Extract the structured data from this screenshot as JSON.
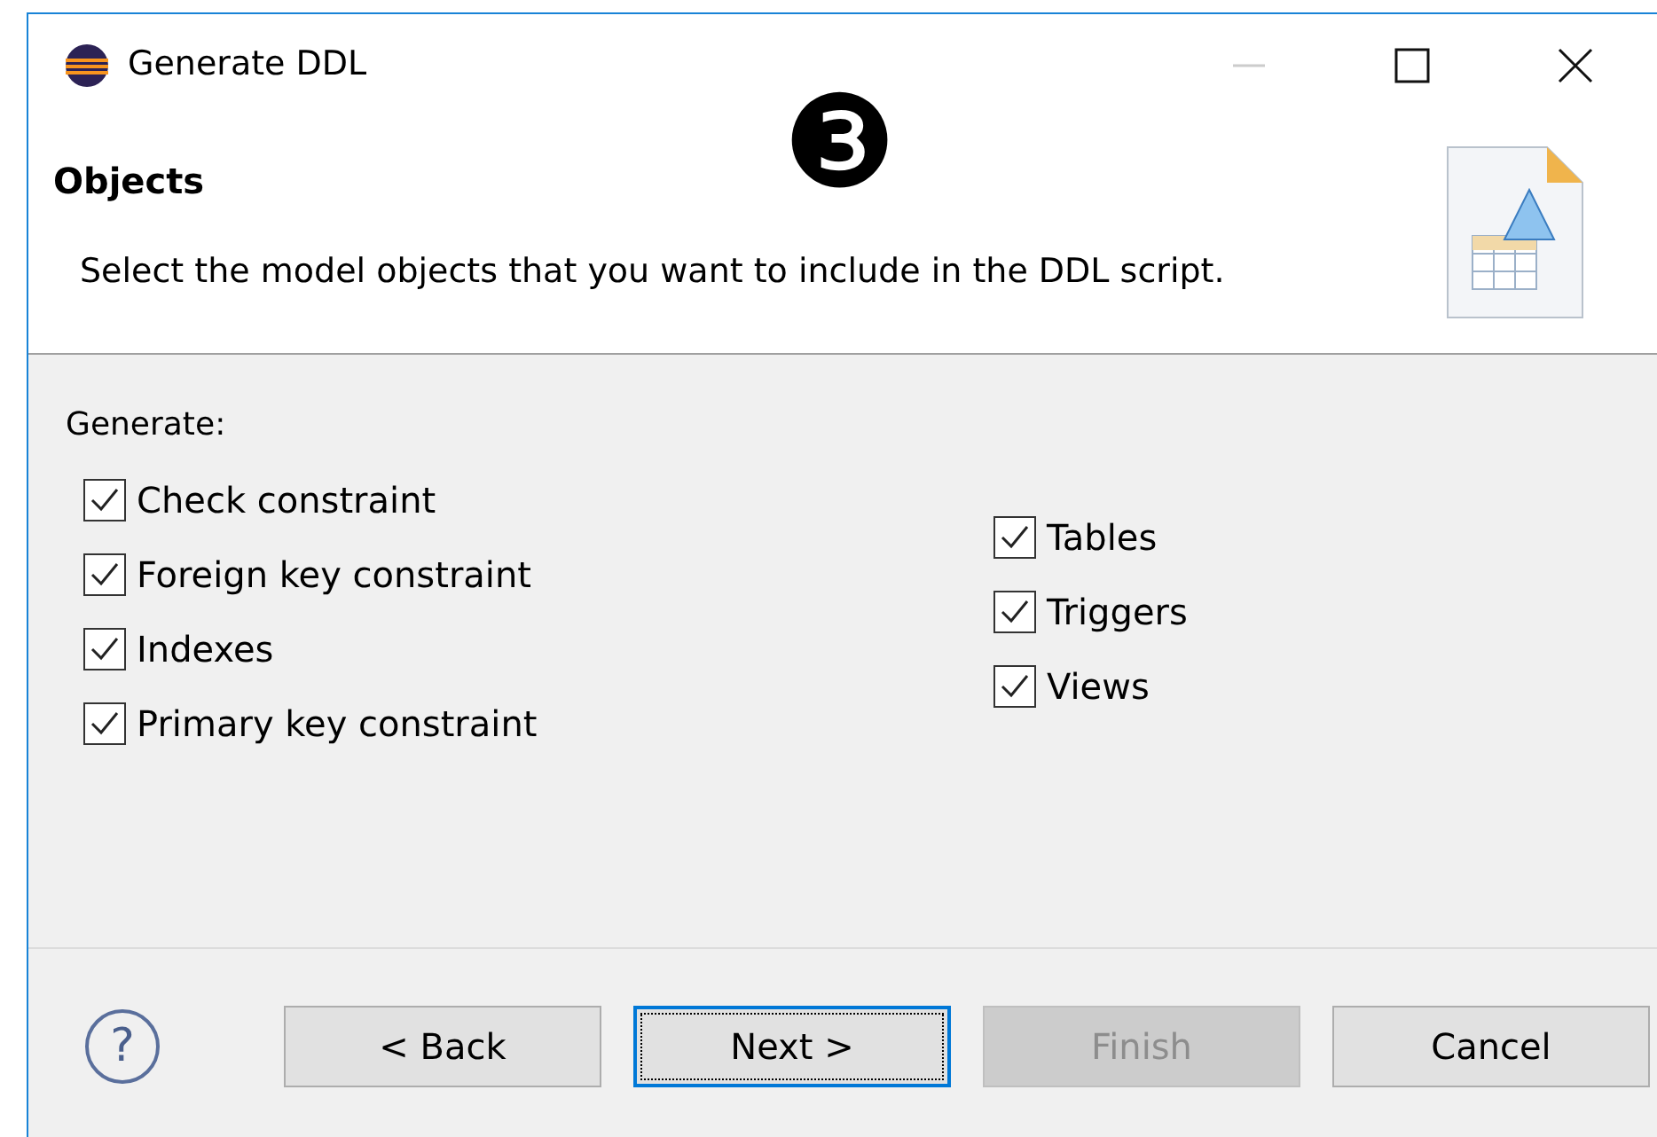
{
  "window": {
    "title": "Generate DDL"
  },
  "callout": "❸",
  "header": {
    "title": "Objects",
    "description": "Select the model objects that you want to include in the DDL script."
  },
  "generate": {
    "label": "Generate:",
    "columns": [
      [
        {
          "label": "Check constraint",
          "checked": true
        },
        {
          "label": "Foreign key constraint",
          "checked": true
        },
        {
          "label": "Indexes",
          "checked": true
        },
        {
          "label": "Primary key constraint",
          "checked": true
        }
      ],
      [
        {
          "label": "Tables",
          "checked": true
        },
        {
          "label": "Triggers",
          "checked": true
        },
        {
          "label": "Views",
          "checked": true
        }
      ]
    ]
  },
  "help": "?",
  "buttons": [
    {
      "label": "< Back",
      "focused": false,
      "disabled": false
    },
    {
      "label": "Next >",
      "focused": true,
      "disabled": false
    },
    {
      "label": "Finish",
      "focused": false,
      "disabled": true
    },
    {
      "label": "Cancel",
      "focused": false,
      "disabled": false
    }
  ]
}
